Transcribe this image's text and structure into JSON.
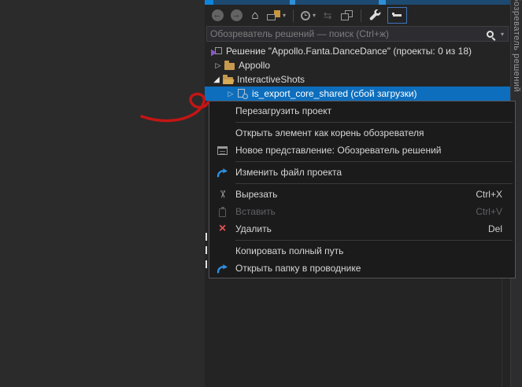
{
  "colors": {
    "selection_blue": "#0d6ebd",
    "menu_bg": "#1b1b1c",
    "panel_bg": "#242425",
    "folder_yellow": "#c59a4f",
    "delete_red": "#e05252",
    "link_arrow_blue": "#2f8fe0",
    "annotation_red": "#c41515",
    "titlebar_navy": "#1d4a70"
  },
  "toolbar": {
    "buttons": [
      "back",
      "forward",
      "home",
      "switch-views",
      "pending-changes-filter",
      "sync-with-active-document",
      "show-all-files",
      "properties-wrench",
      "preview-selected-items"
    ]
  },
  "search": {
    "placeholder": "Обозреватель решений — поиск (Ctrl+ж)"
  },
  "tree": {
    "items": [
      {
        "label": "Решение \"Appollo.Fanta.DanceDance\" (проекты: 0 из 18)",
        "icon": "solution",
        "level": 0,
        "selected": false
      },
      {
        "label": "Appollo",
        "icon": "folder-closed",
        "expander": "collapsed",
        "level": 1,
        "selected": false
      },
      {
        "label": "InteractiveShots",
        "icon": "folder-open",
        "expander": "expanded",
        "level": 1,
        "selected": false
      },
      {
        "label": "is_export_core_shared (сбой загрузки)",
        "icon": "project-unloaded",
        "expander": "collapsed",
        "level": 2,
        "selected": true
      }
    ]
  },
  "context_menu": {
    "items": [
      {
        "label": "Перезагрузить проект",
        "shortcut": "",
        "icon": "",
        "enabled": true
      },
      {
        "label": "Открыть элемент как корень обозревателя",
        "shortcut": "",
        "icon": "",
        "enabled": true
      },
      {
        "label": "Новое представление: Обозреватель решений",
        "shortcut": "",
        "icon": "new-view",
        "enabled": true
      },
      {
        "label": "Изменить файл проекта",
        "shortcut": "",
        "icon": "curved-arrow-blue",
        "enabled": true
      },
      {
        "label": "Вырезать",
        "shortcut": "Ctrl+X",
        "icon": "scissors",
        "enabled": true
      },
      {
        "label": "Вставить",
        "shortcut": "Ctrl+V",
        "icon": "clipboard",
        "enabled": false
      },
      {
        "label": "Удалить",
        "shortcut": "Del",
        "icon": "red-x",
        "enabled": true
      },
      {
        "label": "Копировать полный путь",
        "shortcut": "",
        "icon": "",
        "enabled": true
      },
      {
        "label": "Открыть папку в проводнике",
        "shortcut": "",
        "icon": "curved-arrow-blue",
        "enabled": true
      }
    ]
  },
  "side_tab": {
    "label": "Обозреватель решений"
  },
  "annotation": {
    "type": "hand-drawn-arrow",
    "points_to": "Перезагрузить проект"
  }
}
